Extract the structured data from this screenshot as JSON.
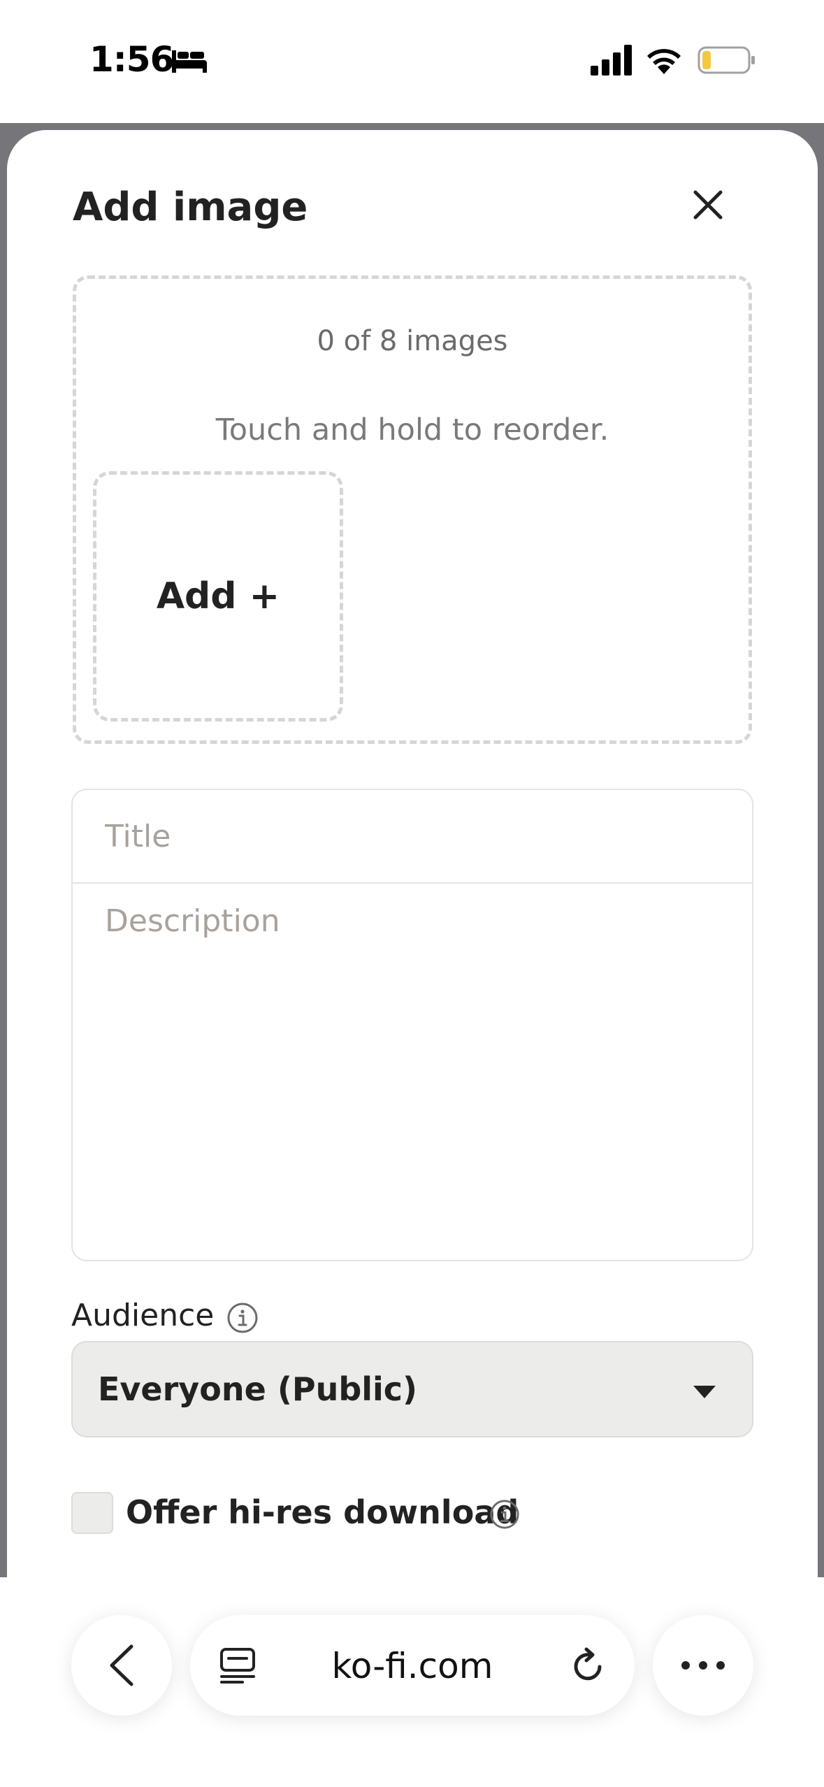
{
  "status_bar": {
    "time": "1:56",
    "icons": [
      "bed-icon",
      "cellular-signal-icon",
      "wifi-icon",
      "battery-low-icon"
    ],
    "battery_color": "#f5c842"
  },
  "sheet": {
    "title": "Add image",
    "close_icon": "close-icon",
    "dropzone": {
      "count_text": "0 of 8 images",
      "hint": "Touch and hold to reorder.",
      "add_label": "Add +"
    },
    "title_field": {
      "placeholder": "Title",
      "value": ""
    },
    "description_field": {
      "placeholder": "Description",
      "value": ""
    },
    "audience": {
      "label": "Audience",
      "info_icon": "info-icon",
      "selected": "Everyone (Public)"
    },
    "hires": {
      "label": "Offer hi-res download",
      "checked": false,
      "info_icon": "info-icon"
    }
  },
  "browser": {
    "url": "ko-fi.com",
    "icons": [
      "back-chevron-icon",
      "tab-overview-icon",
      "reload-icon",
      "more-icon"
    ]
  },
  "colors": {
    "backdrop": "#76767a",
    "text": "#222222",
    "muted": "#7a7a7a",
    "placeholder": "#a8a29c",
    "dashed_border": "#d6d6d6",
    "select_bg": "#ececea"
  }
}
